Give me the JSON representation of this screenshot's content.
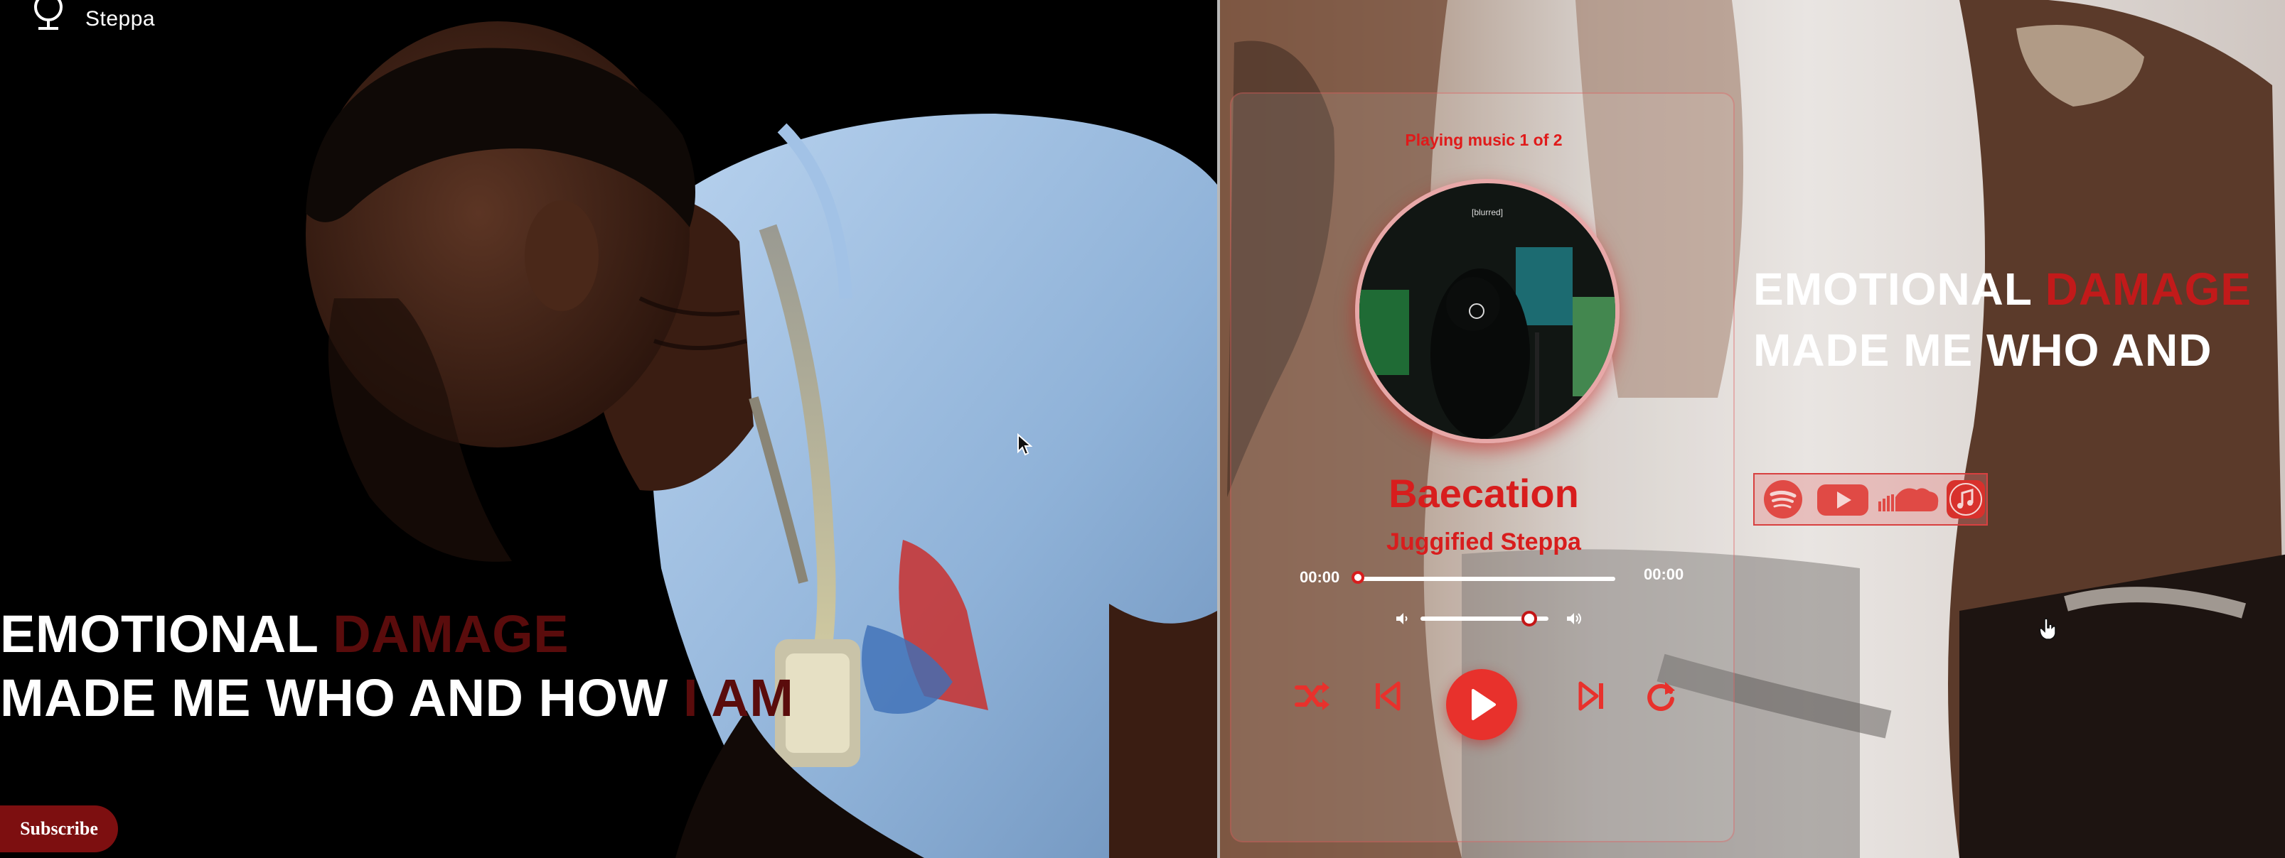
{
  "left_panel": {
    "logo": {
      "text": "Steppa",
      "icon": "microphone-icon"
    },
    "headline": {
      "line1_main": "EMOTIONAL ",
      "line1_accent": "DAMAGE",
      "line2_main": "MADE ME WHO AND HOW ",
      "line2_accent": "I AM"
    },
    "subscribe_label": "Subscribe"
  },
  "player": {
    "status": "Playing music 1 of 2",
    "album_label": "[blurred]",
    "title": "Baecation",
    "artist": "Juggified Steppa",
    "time_current": "00:00",
    "time_total": "00:00",
    "progress": 0.0,
    "volume": 0.85,
    "controls": [
      "shuffle-icon",
      "previous-icon",
      "play-icon",
      "next-icon",
      "repeat-icon"
    ]
  },
  "right_panel": {
    "headline": {
      "line1_main": "EMOTIONAL ",
      "line1_accent": "DAMAGE",
      "line2_main": "MADE ME WHO AND"
    },
    "platforms": [
      "spotify-icon",
      "youtube-icon",
      "soundcloud-icon",
      "apple-music-icon"
    ]
  },
  "colors": {
    "accent_red": "#d81d1d",
    "dark_red": "#7d0f10",
    "play_red": "#e8312c",
    "background": "#000000"
  }
}
